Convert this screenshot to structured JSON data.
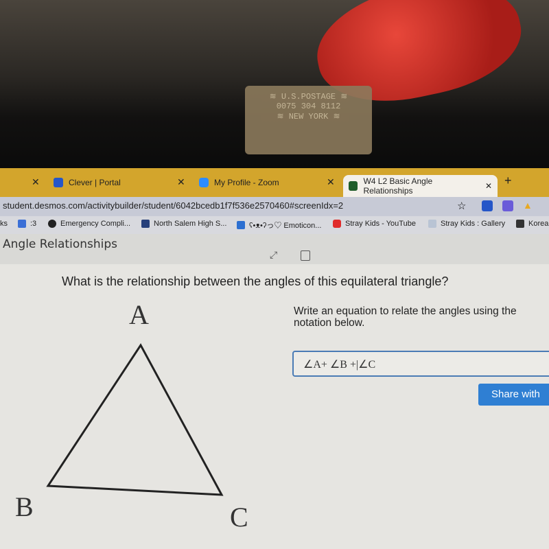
{
  "tabs": [
    {
      "label": "Clever | Portal",
      "icon": "clever-icon"
    },
    {
      "label": "My Profile - Zoom",
      "icon": "zoom-icon"
    },
    {
      "label": "W4 L2 Basic Angle Relationships",
      "icon": "desmos-icon",
      "active": true
    }
  ],
  "address_bar": {
    "url": "student.desmos.com/activitybuilder/student/6042bcedb1f7f536e2570460#screenIdx=2"
  },
  "bookmarks": [
    "ks",
    ":3",
    "Emergency Compli...",
    "North Salem High S...",
    "ʕ•ᴥ•ʔっ♡ Emoticon...",
    "Stray Kids - YouTube",
    "Stray Kids : Gallery",
    "Korea"
  ],
  "stamp_text": "U.S.POSTAGE NEW YORK",
  "page": {
    "title": "Angle Relationships",
    "question": "What is the relationship between the angles of this equilateral triangle?",
    "instruction": "Write an equation to relate the angles using the notation below.",
    "input_value": "∠A+ ∠B +|∠C",
    "share_button": "Share with",
    "vertices": {
      "a": "A",
      "b": "B",
      "c": "C"
    }
  },
  "colors": {
    "tab_bar": "#d3a52c",
    "accent": "#2f7fd3"
  }
}
